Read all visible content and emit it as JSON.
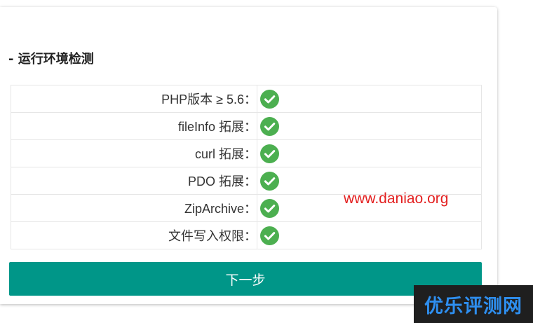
{
  "section": {
    "title": "- 运行环境检测"
  },
  "checks": [
    {
      "label": "PHP版本 ≥ 5.6：",
      "status": "ok"
    },
    {
      "label": "fileInfo 拓展：",
      "status": "ok"
    },
    {
      "label": "curl 拓展：",
      "status": "ok"
    },
    {
      "label": "PDO 拓展：",
      "status": "ok"
    },
    {
      "label": "ZipArchive：",
      "status": "ok"
    },
    {
      "label": "文件写入权限：",
      "status": "ok"
    }
  ],
  "icons": {
    "check": "check-circle-icon"
  },
  "colors": {
    "accent": "#009688",
    "check": "#4caf50",
    "watermark": "#e32020",
    "brand": "#2e8ff0"
  },
  "buttons": {
    "next_label": "下一步"
  },
  "watermark": "www.daniao.org",
  "brand": "优乐评测网"
}
